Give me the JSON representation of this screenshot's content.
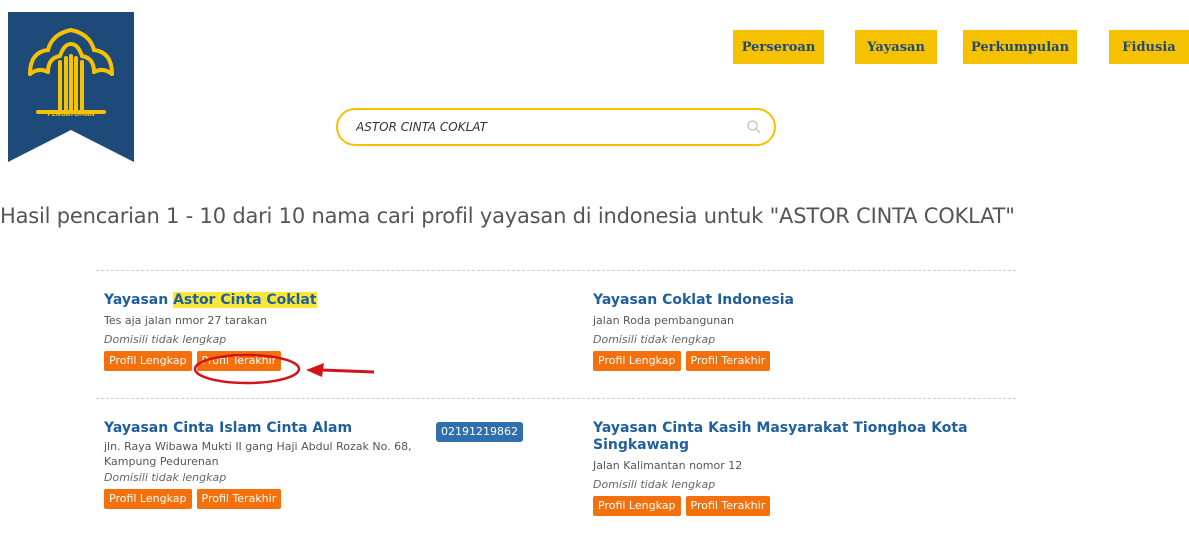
{
  "logo": {
    "text": "PENGAYOMAN"
  },
  "nav": [
    {
      "label": "Perseroan"
    },
    {
      "label": "Yayasan"
    },
    {
      "label": "Perkumpulan"
    },
    {
      "label": "Fidusia"
    }
  ],
  "search": {
    "value": "ASTOR CINTA COKLAT",
    "icon": "search-icon"
  },
  "results_heading": "Hasil pencarian 1 - 10 dari 10 nama cari profil yayasan di indonesia untuk \"ASTOR CINTA COKLAT\"",
  "buttons": {
    "full_profile": "Profil Lengkap",
    "latest_profile": "Profil Terakhir"
  },
  "results": [
    {
      "title_prefix": "Yayasan ",
      "title_highlight": "Astor Cinta Coklat",
      "address": "Tes aja jalan nmor 27 tarakan",
      "domicile": "Domisili tidak lengkap"
    },
    {
      "title": "Yayasan Coklat Indonesia",
      "address": "jalan Roda pembangunan",
      "domicile": "Domisili tidak lengkap"
    },
    {
      "title": "Yayasan Cinta Islam Cinta Alam",
      "address": "jln. Raya Wibawa Mukti II gang Haji Abdul Rozak No. 68, Kampung Pedurenan",
      "domicile": "Domisili tidak lengkap",
      "phone": "02191219862"
    },
    {
      "title": "Yayasan Cinta Kasih Masyarakat Tionghoa Kota Singkawang",
      "address": "Jalan Kalimantan nomor 12",
      "domicile": "Domisili tidak lengkap"
    }
  ],
  "colors": {
    "accent": "#f6c200",
    "button": "#f3700d",
    "link": "#1f5f9e",
    "highlight": "#f8e63a",
    "annotation": "#d4121c",
    "phone_badge": "#2f6fae"
  }
}
